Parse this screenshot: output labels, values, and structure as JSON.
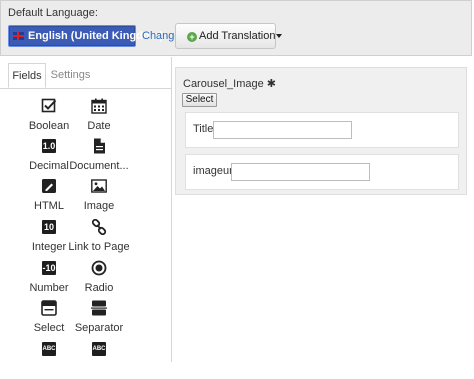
{
  "language": {
    "title": "Default Language:",
    "selected": "English (United Kingdom)",
    "change_label": "Change",
    "add_translation_label": "Add Translation"
  },
  "tabs": [
    {
      "label": "Fields",
      "active": true
    },
    {
      "label": "Settings",
      "active": false
    }
  ],
  "fields": [
    {
      "label": "Boolean",
      "icon": "checkbox-icon"
    },
    {
      "label": "Date",
      "icon": "calendar-icon"
    },
    {
      "label": "Decimal",
      "icon": "decimal-icon",
      "icon_text": "1.0"
    },
    {
      "label": "Document...",
      "icon": "document-icon"
    },
    {
      "label": "HTML",
      "icon": "html-edit-icon"
    },
    {
      "label": "Image",
      "icon": "image-icon"
    },
    {
      "label": "Integer",
      "icon": "integer-icon",
      "icon_text": "10"
    },
    {
      "label": "Link to Page",
      "icon": "link-icon"
    },
    {
      "label": "Number",
      "icon": "number-icon",
      "icon_text": "-10"
    },
    {
      "label": "Radio",
      "icon": "radio-icon"
    },
    {
      "label": "Select",
      "icon": "select-icon"
    },
    {
      "label": "Separator",
      "icon": "separator-icon"
    },
    {
      "label": "",
      "icon": "text-field-icon",
      "icon_text": "ABC"
    },
    {
      "label": "",
      "icon": "text-area-icon",
      "icon_text": "ABC"
    }
  ],
  "editor": {
    "title": "Carousel_Image",
    "required_marker": "✱",
    "select_label": "Select",
    "subfields": [
      {
        "label": "Title",
        "value": ""
      },
      {
        "label": "imageurl",
        "value": ""
      }
    ]
  },
  "colors": {
    "language_button": "#3b5bb4",
    "link": "#2a6bb8",
    "add_icon": "#5aa84b"
  }
}
